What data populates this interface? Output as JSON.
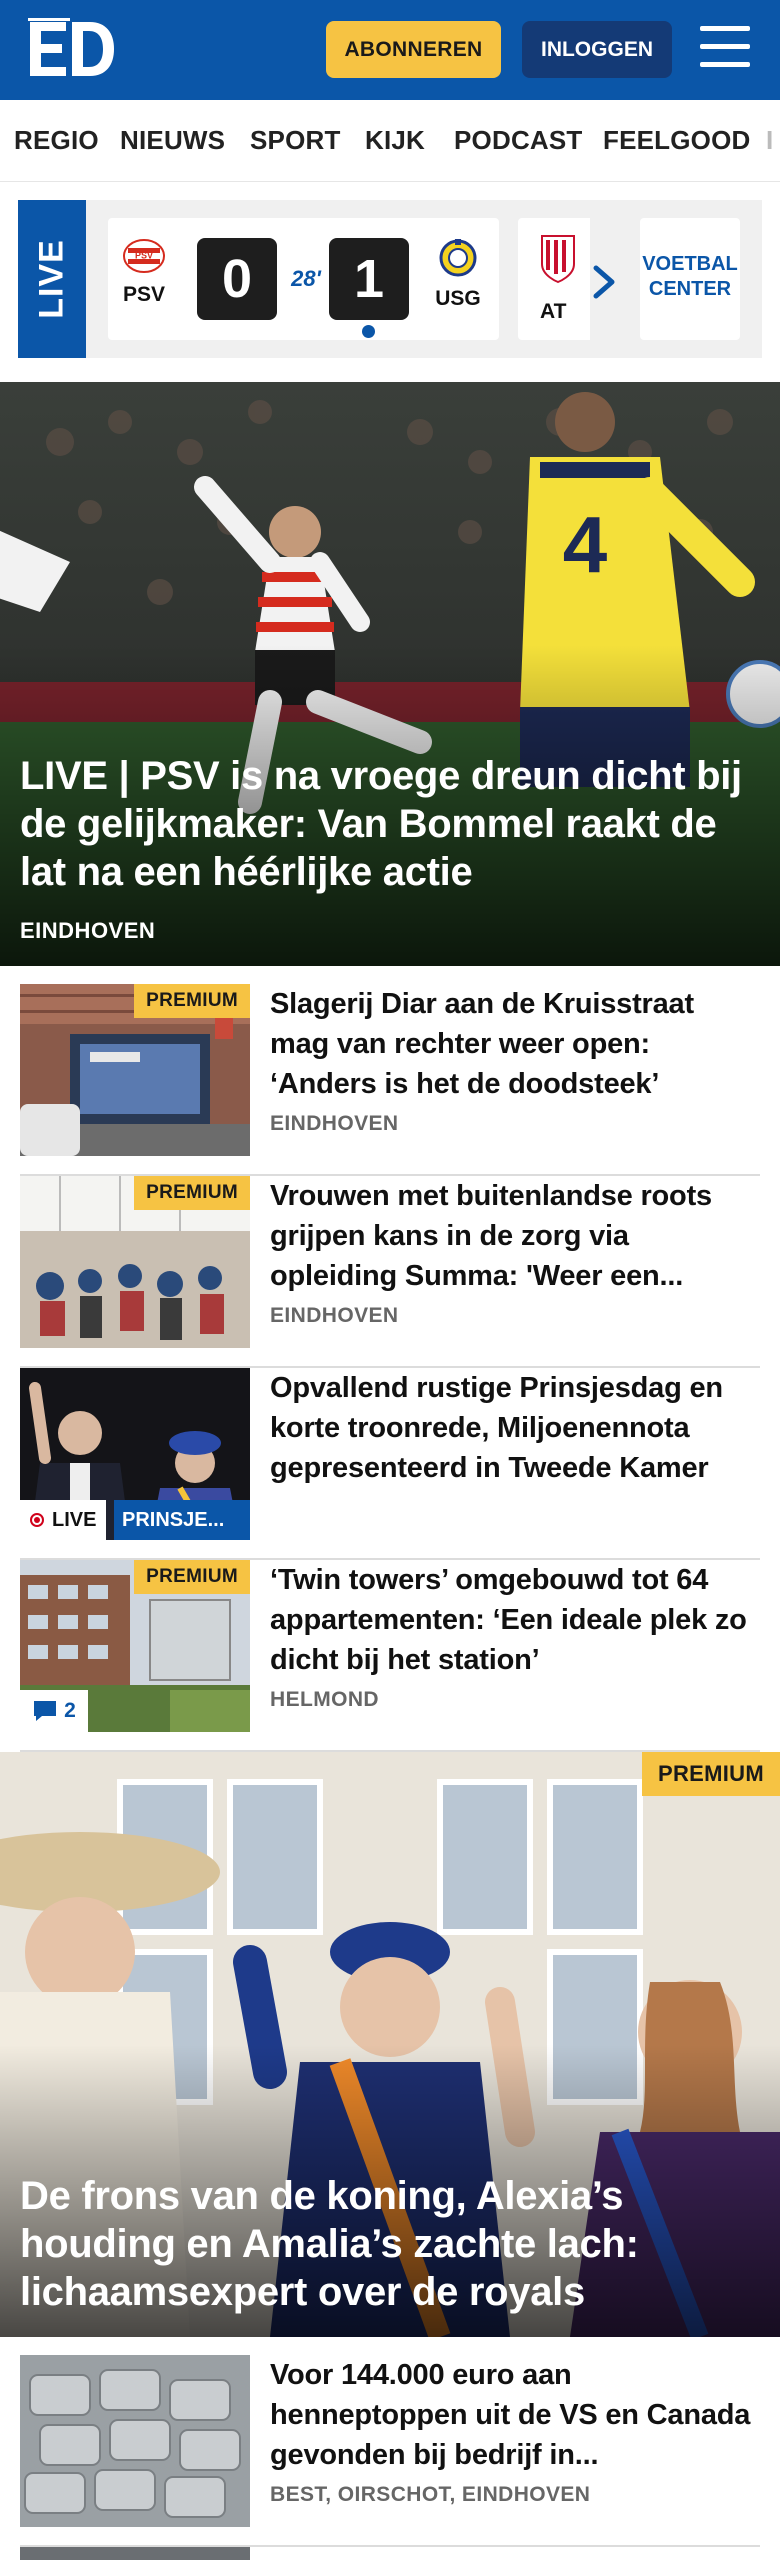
{
  "header": {
    "subscribe_label": "ABONNEREN",
    "login_label": "INLOGGEN",
    "brand_color": "#0b56a8",
    "accent_color": "#f6c343"
  },
  "nav": {
    "items": [
      "REGIO",
      "NIEUWS",
      "SPORT",
      "KIJK",
      "PODCAST",
      "FEELGOOD"
    ]
  },
  "live_scores": {
    "live_label": "LIVE",
    "match": {
      "home_team": "PSV",
      "away_team": "USG",
      "home_score": "0",
      "away_score": "1",
      "minute": "28'"
    },
    "next_match_team": "AT",
    "voetbal_center_label": "VOETBAL CENTER"
  },
  "hero": {
    "title": "LIVE | PSV is na vroege dreun dicht bij de gelijkmaker: Van Bommel raakt de lat na een héérlijke actie",
    "location": "EINDHOVEN"
  },
  "articles": [
    {
      "title": "Slagerij Diar aan de Kruisstraat mag van rechter weer open: ‘Anders is het de doodsteek’",
      "location": "EINDHOVEN",
      "badge": "PREMIUM"
    },
    {
      "title": "Vrouwen met buitenlandse roots grijpen kans in de zorg via opleiding Summa: 'Weer een...",
      "location": "EINDHOVEN",
      "badge": "PREMIUM"
    },
    {
      "title": "Opvallend rustige Prinsjesdag en korte troonrede, Miljoenennota gepresenteerd in Tweede Kamer",
      "live_label": "LIVE",
      "tag": "PRINSJE..."
    },
    {
      "title": "‘Twin towers’ omgebouwd tot 64 appartementen: ‘Een ideale plek zo dicht bij het station’",
      "location": "HELMOND",
      "badge": "PREMIUM",
      "comments": "2"
    }
  ],
  "feature": {
    "badge": "PREMIUM",
    "title": "De frons van de koning, Alexia’s houding en Amalia’s zachte lach: lichaamsexpert over de royals"
  },
  "articles_2": [
    {
      "title": "Voor 144.000 euro aan henneptoppen uit de VS en Canada gevonden bij bedrijf in...",
      "location": "BEST, OIRSCHOT, EINDHOVEN"
    }
  ]
}
